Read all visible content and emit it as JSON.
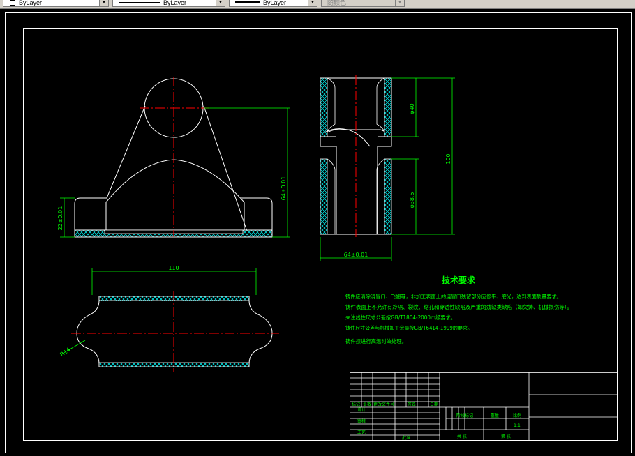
{
  "toolbar": {
    "color_value": "ByLayer",
    "linetype_value": "ByLayer",
    "lineweight_value": "ByLayer",
    "plotstyle_value": "随颜色",
    "dropdown_arrow": "chevron-down-icon"
  },
  "drawing": {
    "background": "#000000",
    "line_color": "#ffffff",
    "center_color": "#ff0000",
    "dim_color": "#00ff00",
    "hatch_color": "#00ffff",
    "dims": {
      "height_front": "64±0.01",
      "base_height": "22±0.01",
      "dim_side_top": "φ40",
      "dim_side_total": "100",
      "dim_side_lower": "φ38.5",
      "width_side": "64±0.01",
      "width_bottom": "110",
      "radius_bottom": "R14"
    },
    "notes": {
      "title": "技术要求",
      "lines": [
        "铸件应清除浇冒口、飞翅等，非加工表面上的浇冒口残留部分应修平、磨光，达到表面质量要求。",
        "铸件表面上不允许有冷隔、裂纹、缩孔和穿透性缺陷及严重的残缺类缺陷（如欠铸、机械损伤等）。",
        "未注线性尺寸公差按GB/T1804-2000m级要求。",
        "铸件尺寸公差与机械加工余量按GB/T6414-1999的要求。",
        "铸件须进行高温时效处理。"
      ]
    },
    "title_block": {
      "mark": "标记",
      "count": "处数",
      "doc_no": "更改文件号",
      "signature": "签名",
      "date": "日期",
      "design": "设计",
      "review": "审核",
      "process": "工艺",
      "approve": "批准",
      "stage_mark": "阶段标记",
      "weight": "重量",
      "scale_label": "比例",
      "scale_value": "1:1",
      "sheets_total": "共 张",
      "sheet_no": "第 张"
    }
  }
}
